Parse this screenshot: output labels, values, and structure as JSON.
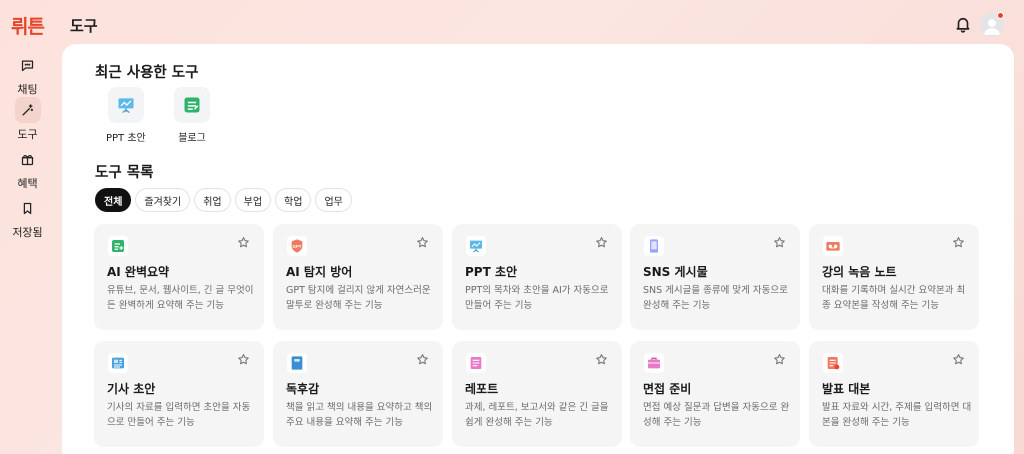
{
  "app": {
    "logo": "뤼튼"
  },
  "sidebar": {
    "items": [
      {
        "label": "채팅",
        "icon": "chat-icon"
      },
      {
        "label": "도구",
        "icon": "magic-wand-icon",
        "active": true
      },
      {
        "label": "혜택",
        "icon": "gift-icon"
      },
      {
        "label": "저장됨",
        "icon": "bookmark-icon"
      }
    ]
  },
  "header": {
    "title": "도구",
    "notification_icon": "bell-icon",
    "has_unread": true
  },
  "recent": {
    "title": "최근 사용한 도구",
    "items": [
      {
        "label": "PPT 초안",
        "icon": "presentation-icon"
      },
      {
        "label": "블로그",
        "icon": "blog-icon"
      }
    ]
  },
  "tools": {
    "title": "도구 목록",
    "filters": [
      "전체",
      "즐겨찾기",
      "취업",
      "부업",
      "학업",
      "업무"
    ],
    "active_filter": "전체",
    "cards": [
      {
        "title": "AI 완벽요약",
        "desc": "유튜브, 문서, 웹사이트, 긴 글 무엇이든 완벽하게 요약해 주는 기능",
        "icon": "summary-icon"
      },
      {
        "title": "AI 탐지 방어",
        "desc": "GPT 탐지에 걸리지 않게 자연스러운 말투로 완성해 주는 기능",
        "icon": "gpt-shield-icon"
      },
      {
        "title": "PPT 초안",
        "desc": "PPT의 목차와 초안을 AI가 자동으로 만들어 주는 기능",
        "icon": "presentation-icon"
      },
      {
        "title": "SNS 게시물",
        "desc": "SNS 게시글을 종류에 맞게 자동으로 완성해 주는 기능",
        "icon": "phone-icon"
      },
      {
        "title": "강의 녹음 노트",
        "desc": "대화를 기록하며 실시간 요약본과 최종 요약본을 작성해 주는 기능",
        "icon": "recorder-icon"
      },
      {
        "title": "기사 초안",
        "desc": "기사의 자료를 입력하면 초안을 자동으로 만들어 주는 기능",
        "icon": "newspaper-icon"
      },
      {
        "title": "독후감",
        "desc": "책을 읽고 책의 내용을 요약하고 책의 주요 내용을 요약해 주는 기능",
        "icon": "book-icon"
      },
      {
        "title": "레포트",
        "desc": "과제, 레포트, 보고서와 같은 긴 글을 쉽게 완성해 주는 기능",
        "icon": "report-icon"
      },
      {
        "title": "면접 준비",
        "desc": "면접 예상 질문과 답변을 자동으로 완성해 주는 기능",
        "icon": "briefcase-icon"
      },
      {
        "title": "발표 대본",
        "desc": "발표 자료와 시간, 주제를 입력하면 대본을 완성해 주는 기능",
        "icon": "script-icon"
      }
    ]
  },
  "colors": {
    "brand": "#e8452c",
    "card_bg": "#f5f5f6",
    "active_chip": "#111111"
  }
}
